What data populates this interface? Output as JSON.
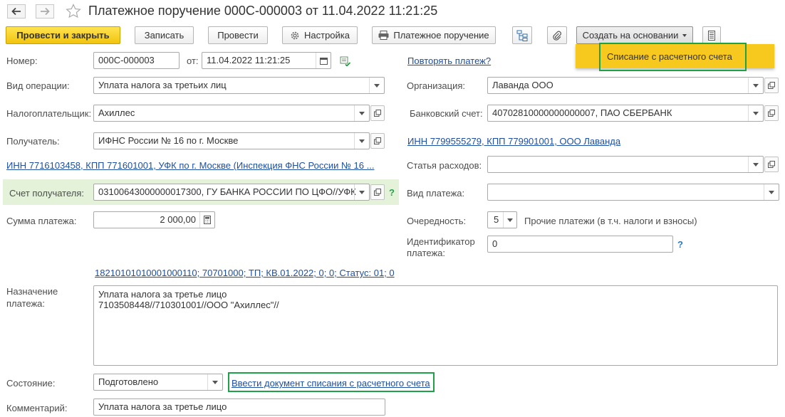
{
  "title": "Платежное поручение 000С-000003 от 11.04.2022 11:21:25",
  "toolbar": {
    "post_close": "Провести и закрыть",
    "save": "Записать",
    "post": "Провести",
    "settings": "Настройка",
    "print": "Платежное поручение",
    "create_based": "Создать на основании"
  },
  "dropdown_menu": {
    "item": "Списание с расчетного счета"
  },
  "form": {
    "number_label": "Номер:",
    "number_value": "000С-000003",
    "date_label": "от:",
    "date_value": "11.04.2022 11:21:25",
    "repeat_link": "Повторять платеж?",
    "operation_label": "Вид операции:",
    "operation_value": "Уплата налога за третьих лиц",
    "org_label": "Организация:",
    "org_value": "Лаванда ООО",
    "taxpayer_label": "Налогоплательщик:",
    "taxpayer_value": "Ахиллес",
    "bank_label": "Банковский счет:",
    "bank_value": "40702810000000000007, ПАО СБЕРБАНК",
    "recipient_label": "Получатель:",
    "recipient_value": "ИФНС России № 16 по г. Москве",
    "org_inn_link": "ИНН 7799555279, КПП 779901001, ООО Лаванда",
    "recipient_inn_link": "ИНН 7716103458, КПП 771601001, УФК по г. Москве (Инспекция ФНС России № 16 ...",
    "expense_label": "Статья расходов:",
    "expense_value": "",
    "account_label": "Счет получателя:",
    "account_value": "03100643000000017300, ГУ БАНКА РОССИИ ПО ЦФО//УФК",
    "payment_type_label": "Вид платежа:",
    "payment_type_value": "",
    "amount_label": "Сумма платежа:",
    "amount_value": "2 000,00",
    "priority_label": "Очередность:",
    "priority_value": "5",
    "priority_desc": "Прочие платежи (в т.ч. налоги и взносы)",
    "identifier_label_1": "Идентификатор",
    "identifier_label_2": "платежа:",
    "identifier_value": "0",
    "details_link": "18210101010001000110; 70701000; ТП; КВ.01.2022; 0; 0; Статус: 01; 0",
    "purpose_label_1": "Назначение",
    "purpose_label_2": "платежа:",
    "purpose_line_1": "Уплата налога за третье лицо",
    "purpose_line_2": "7103508448//710301001//ООО \"Ахиллес\"//",
    "state_label": "Состояние:",
    "state_value": "Подготовлено",
    "writeoff_link": "Ввести документ списания с расчетного счета",
    "comment_label": "Комментарий:",
    "comment_value": "Уплата налога за третье лицо",
    "help": "?"
  }
}
